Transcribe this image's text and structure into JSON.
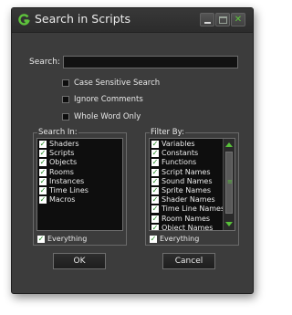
{
  "window": {
    "title": "Search in Scripts"
  },
  "search": {
    "label": "Search:",
    "value": ""
  },
  "options": [
    {
      "label": "Case Sensitive Search",
      "checked": false
    },
    {
      "label": "Ignore Comments",
      "checked": false
    },
    {
      "label": "Whole Word Only",
      "checked": false
    }
  ],
  "search_in": {
    "title": "Search In:",
    "items": [
      "Shaders",
      "Scripts",
      "Objects",
      "Rooms",
      "Instances",
      "Time Lines",
      "Macros"
    ],
    "everything_label": "Everything"
  },
  "filter_by": {
    "title": "Filter By:",
    "items": [
      "Variables",
      "Constants",
      "Functions",
      "Script Names",
      "Sound Names",
      "Sprite Names",
      "Shader Names",
      "Time Line Names",
      "Room Names",
      "Object Names"
    ],
    "everything_label": "Everything"
  },
  "buttons": {
    "ok": "OK",
    "cancel": "Cancel"
  },
  "colors": {
    "accent_green": "#58c03a",
    "window_bg": "#3c3c3c",
    "list_bg": "#0e0e0e"
  }
}
